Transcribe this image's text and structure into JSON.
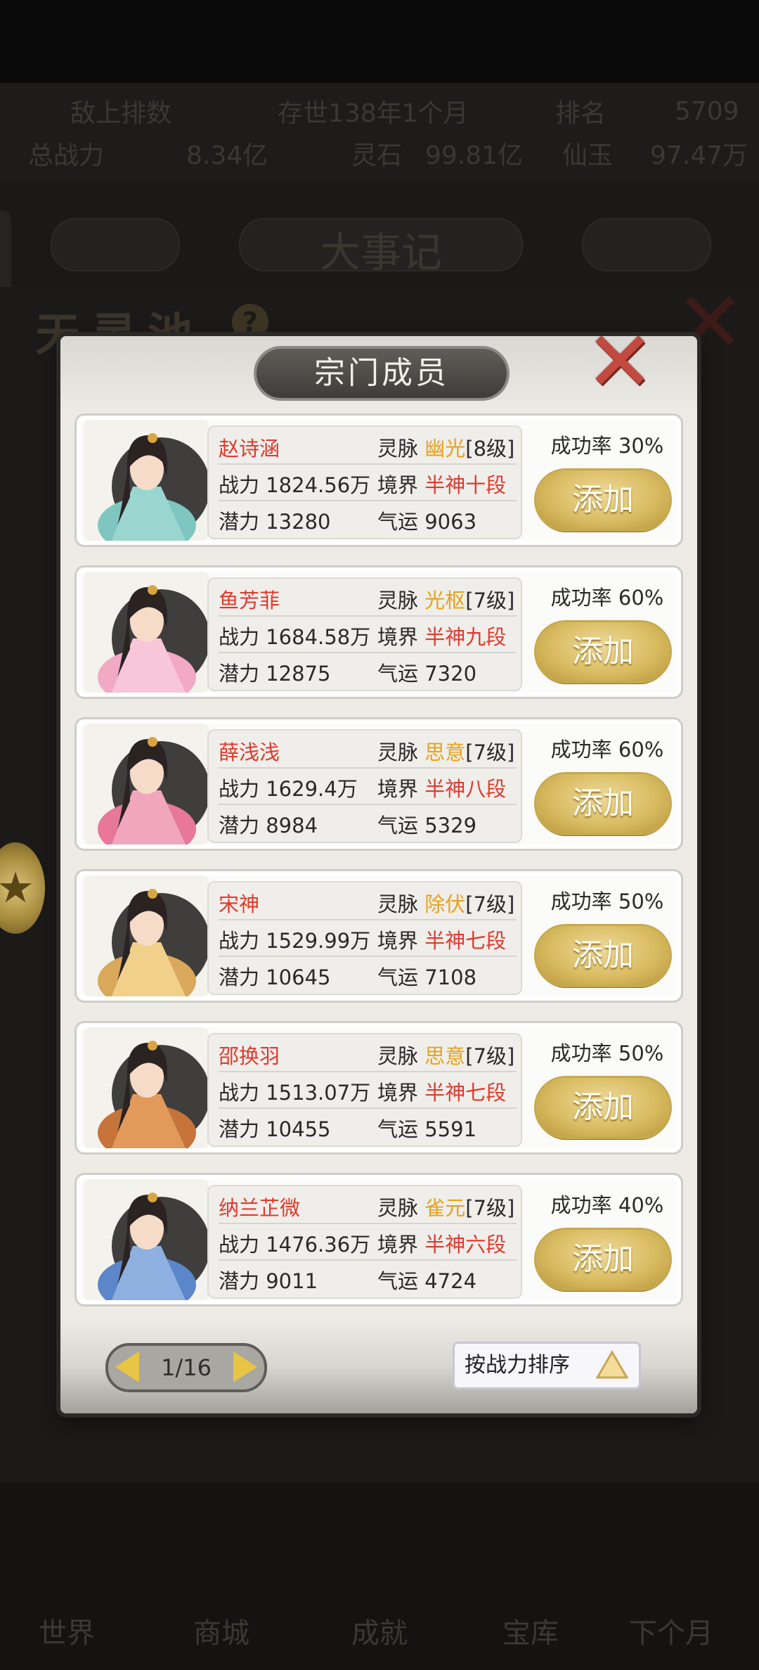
{
  "background": {
    "stats_row1": [
      "敌上排数",
      "存世138年1个月",
      "排名",
      "5709"
    ],
    "stats_row2": [
      "总战力",
      "8.34亿",
      "灵石",
      "99.81亿",
      "仙玉",
      "97.47万"
    ],
    "event_title": "大事记",
    "scroll_title": "天灵池",
    "bottom_nav": [
      "世界",
      "商城",
      "成就",
      "宝库",
      "下个月"
    ]
  },
  "modal": {
    "title": "宗门成员",
    "close_label": "✕",
    "add_label": "添加",
    "labels": {
      "vein": "灵脉",
      "power": "战力",
      "realm": "境界",
      "potential": "潜力",
      "luck": "气运",
      "rate": "成功率"
    },
    "members": [
      {
        "name": "赵诗涵",
        "vein": "幽光",
        "vein_level": "[8级]",
        "power": "1824.56万",
        "realm": "半神十段",
        "potential": "13280",
        "luck": "9063",
        "rate": "30%"
      },
      {
        "name": "鱼芳菲",
        "vein": "光枢",
        "vein_level": "[7级]",
        "power": "1684.58万",
        "realm": "半神九段",
        "potential": "12875",
        "luck": "7320",
        "rate": "60%"
      },
      {
        "name": "薛浅浅",
        "vein": "思意",
        "vein_level": "[7级]",
        "power": "1629.4万",
        "realm": "半神八段",
        "potential": "8984",
        "luck": "5329",
        "rate": "60%"
      },
      {
        "name": "宋神",
        "vein": "除伏",
        "vein_level": "[7级]",
        "power": "1529.99万",
        "realm": "半神七段",
        "potential": "10645",
        "luck": "7108",
        "rate": "50%"
      },
      {
        "name": "邵换羽",
        "vein": "思意",
        "vein_level": "[7级]",
        "power": "1513.07万",
        "realm": "半神七段",
        "potential": "10455",
        "luck": "5591",
        "rate": "50%"
      },
      {
        "name": "纳兰芷微",
        "vein": "雀元",
        "vein_level": "[7级]",
        "power": "1476.36万",
        "realm": "半神六段",
        "potential": "9011",
        "luck": "4724",
        "rate": "40%"
      }
    ],
    "pager": {
      "text": "1/16"
    },
    "sort": {
      "label": "按战力排序"
    }
  },
  "colors": {
    "name": "#e03a2e",
    "vein": "#e7a21c",
    "realm": "#e03a2e",
    "add_button": "#d9bc62",
    "close": "#c24a40"
  }
}
